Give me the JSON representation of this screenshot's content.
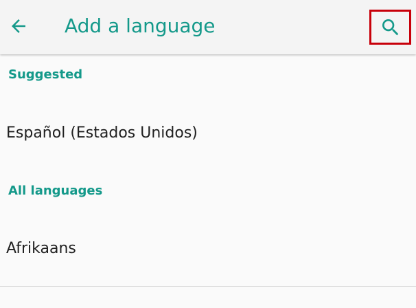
{
  "toolbar": {
    "title": "Add a language",
    "back_icon": "arrow-back-icon",
    "search_icon": "search-icon"
  },
  "sections": {
    "suggested": {
      "header": "Suggested",
      "items": [
        "Español (Estados Unidos)"
      ]
    },
    "all": {
      "header": "All languages",
      "items": [
        "Afrikaans"
      ]
    }
  },
  "colors": {
    "accent": "#14998a",
    "highlight_border": "#c8000a",
    "background": "#fafafa",
    "toolbar": "#f4f4f4",
    "text": "#202020"
  }
}
